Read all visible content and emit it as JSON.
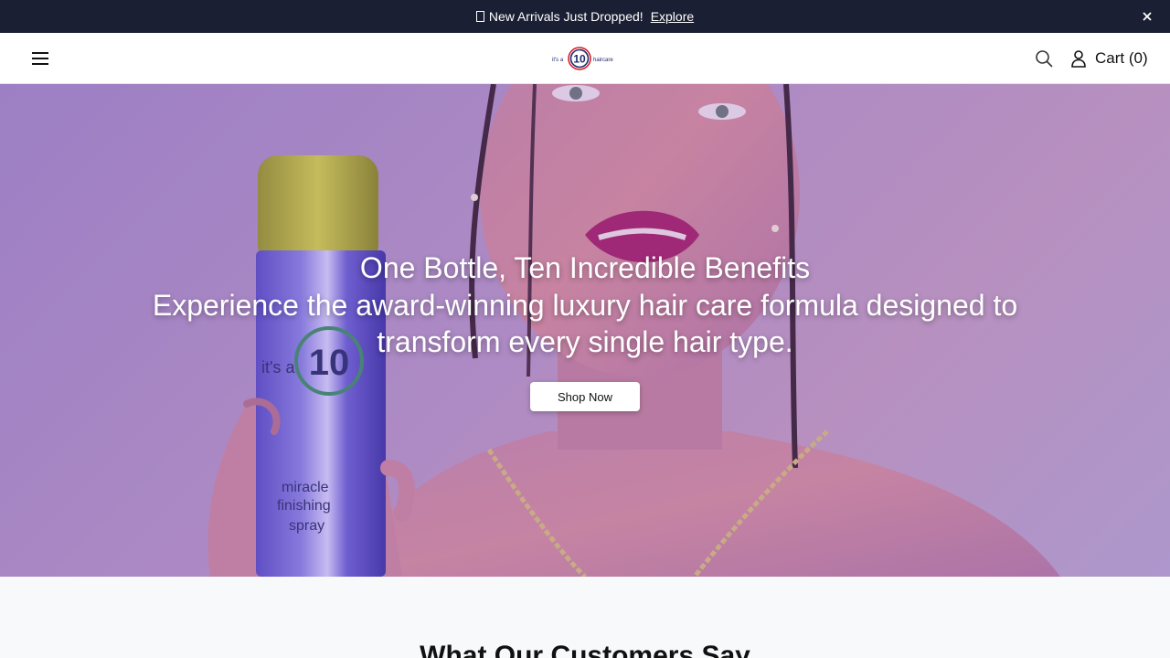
{
  "announcement": {
    "text": "New Arrivals Just Dropped!",
    "link_label": "Explore"
  },
  "header": {
    "logo": {
      "prefix": "it's a",
      "number": "10",
      "suffix": "haircare"
    },
    "cart_label": "Cart (0)"
  },
  "hero": {
    "title": "One Bottle, Ten Incredible Benefits",
    "subtitle": "Experience the award-winning luxury hair care formula designed to transform every single hair type.",
    "cta_label": "Shop Now",
    "product_label": {
      "brand_prefix": "it's a",
      "brand_number": "10",
      "line1": "miracle",
      "line2": "finishing",
      "line3": "spray"
    }
  },
  "reviews": {
    "title": "What Our Customers Say"
  },
  "colors": {
    "announcement_bg": "#1b1f33",
    "hero_overlay": "#a58ac8",
    "logo_navy": "#1f2a6b",
    "logo_red": "#d5232f"
  },
  "icons": [
    "close-icon",
    "hamburger-menu-icon",
    "search-icon",
    "user-icon"
  ]
}
